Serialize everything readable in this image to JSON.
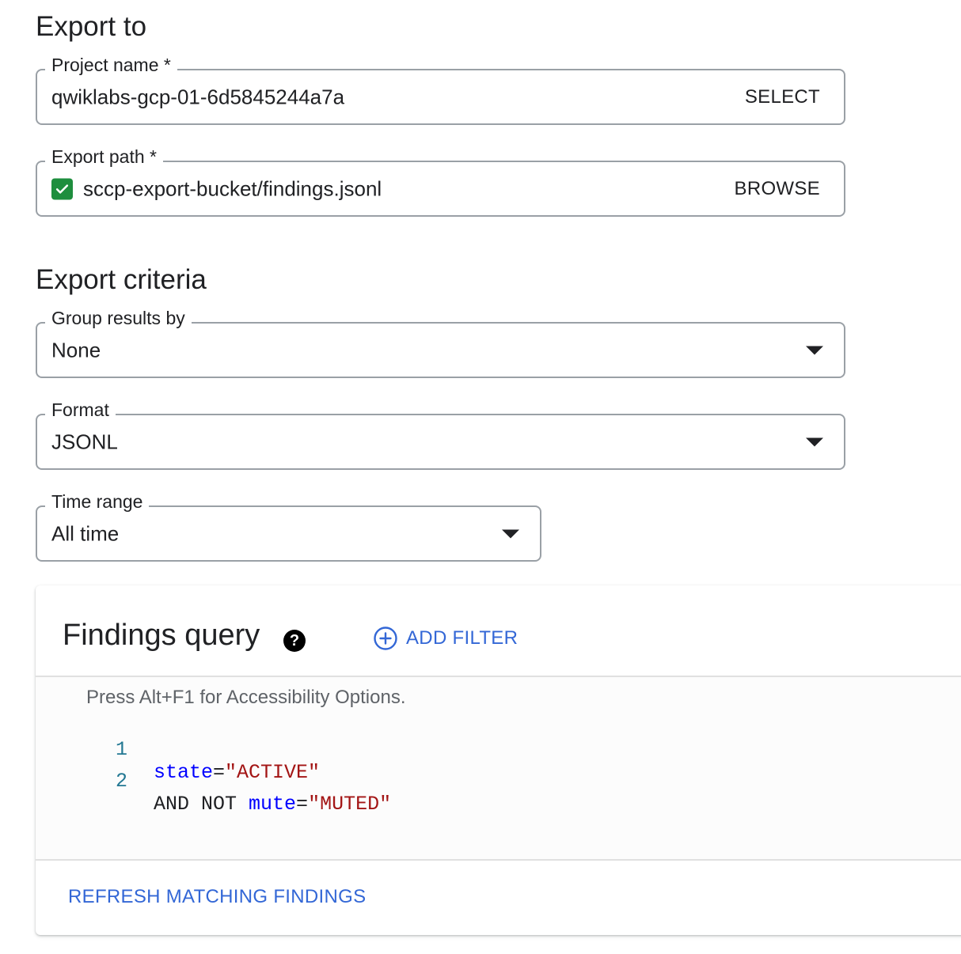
{
  "export_to": {
    "heading": "Export to",
    "project_name": {
      "label": "Project name *",
      "value": "qwiklabs-gcp-01-6d5845244a7a",
      "action": "SELECT"
    },
    "export_path": {
      "label": "Export path *",
      "value": "sccp-export-bucket/findings.jsonl",
      "action": "BROWSE",
      "status_icon": "check-icon",
      "status_color": "#1e8e3e"
    }
  },
  "export_criteria": {
    "heading": "Export criteria",
    "group_results_by": {
      "label": "Group results by",
      "value": "None"
    },
    "format": {
      "label": "Format",
      "value": "JSONL"
    },
    "time_range": {
      "label": "Time range",
      "value": "All time"
    }
  },
  "findings_query": {
    "title": "Findings query",
    "help_icon": "help-circle-icon",
    "help_glyph": "?",
    "add_filter": {
      "icon": "add-circle-icon",
      "label": "ADD FILTER"
    },
    "editor": {
      "a11y_hint": "Press Alt+F1 for Accessibility Options.",
      "lines": [
        {
          "number": "1",
          "kw": "",
          "key": "state",
          "op": "=",
          "str": "\"ACTIVE\""
        },
        {
          "number": "2",
          "kw": "AND NOT ",
          "key": "mute",
          "op": "=",
          "str": "\"MUTED\""
        }
      ]
    },
    "refresh_label": "REFRESH MATCHING FINDINGS"
  },
  "colors": {
    "accent_blue": "#3367d6",
    "success_green": "#1e8e3e",
    "code_keyword_blue": "#0000ff",
    "code_string_red": "#a31515",
    "line_number_teal": "#237893"
  }
}
